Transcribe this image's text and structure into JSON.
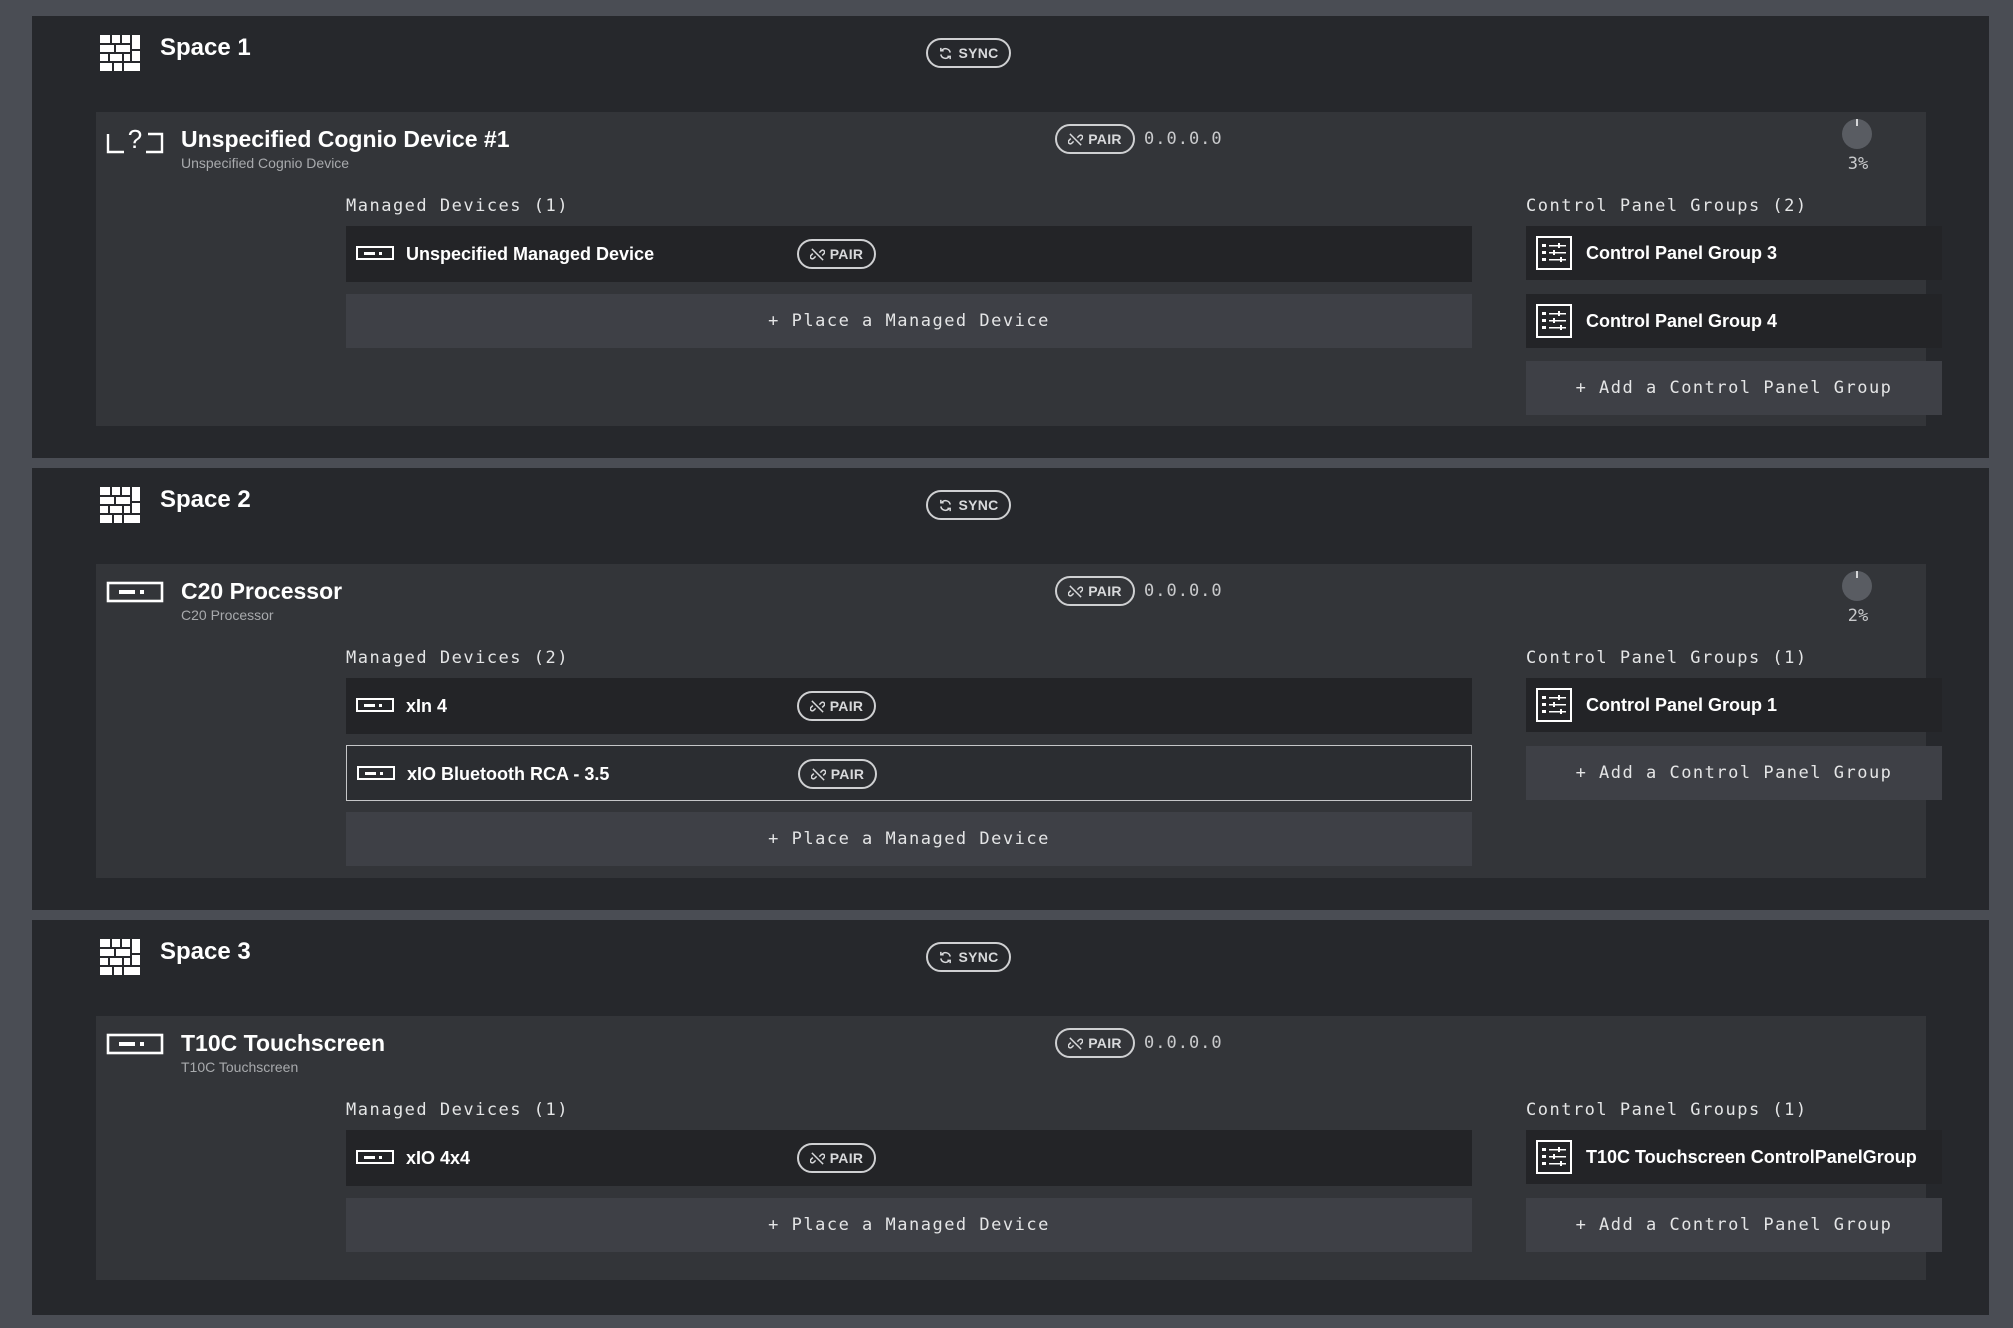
{
  "spaces": [
    {
      "name": "Space 1",
      "sync_label": "SYNC",
      "device": {
        "title": "Unspecified Cognio Device #1",
        "subtitle": "Unspecified Cognio Device",
        "icon": "unknown-device-icon",
        "pair_label": "PAIR",
        "ip": "0.0.0.0",
        "progress_pct": "3%",
        "progress_value": 3,
        "managed_header": "Managed Devices (1)",
        "managed": [
          {
            "name": "Unspecified Managed Device",
            "pair_label": "PAIR"
          }
        ],
        "place_label": "+ Place a Managed Device",
        "cpg_header": "Control Panel Groups (2)",
        "cpgs": [
          {
            "name": "Control Panel Group 3"
          },
          {
            "name": "Control Panel Group 4"
          }
        ],
        "add_cpg_label": "+ Add a Control Panel Group"
      }
    },
    {
      "name": "Space 2",
      "sync_label": "SYNC",
      "device": {
        "title": "C20 Processor",
        "subtitle": "C20 Processor",
        "icon": "processor-icon",
        "pair_label": "PAIR",
        "ip": "0.0.0.0",
        "progress_pct": "2%",
        "progress_value": 2,
        "managed_header": "Managed Devices (2)",
        "managed": [
          {
            "name": "xIn 4",
            "pair_label": "PAIR"
          },
          {
            "name": "xIO Bluetooth RCA - 3.5",
            "pair_label": "PAIR"
          }
        ],
        "place_label": "+ Place a Managed Device",
        "cpg_header": "Control Panel Groups (1)",
        "cpgs": [
          {
            "name": "Control Panel Group 1"
          }
        ],
        "add_cpg_label": "+ Add a Control Panel Group"
      }
    },
    {
      "name": "Space 3",
      "sync_label": "SYNC",
      "device": {
        "title": "T10C Touchscreen",
        "subtitle": "T10C Touchscreen",
        "icon": "processor-icon",
        "pair_label": "PAIR",
        "ip": "0.0.0.0",
        "managed_header": "Managed Devices (1)",
        "managed": [
          {
            "name": "xIO 4x4",
            "pair_label": "PAIR"
          }
        ],
        "place_label": "+ Place a Managed Device",
        "cpg_header": "Control Panel Groups (1)",
        "cpgs": [
          {
            "name": "T10C Touchscreen ControlPanelGroup"
          }
        ],
        "add_cpg_label": "+ Add a Control Panel Group"
      }
    }
  ],
  "colors": {
    "page_bg": "#4a4d54",
    "space_bg": "#26282c",
    "card_bg": "#333539",
    "row_bg": "#232427",
    "add_bg": "#3e4046"
  }
}
